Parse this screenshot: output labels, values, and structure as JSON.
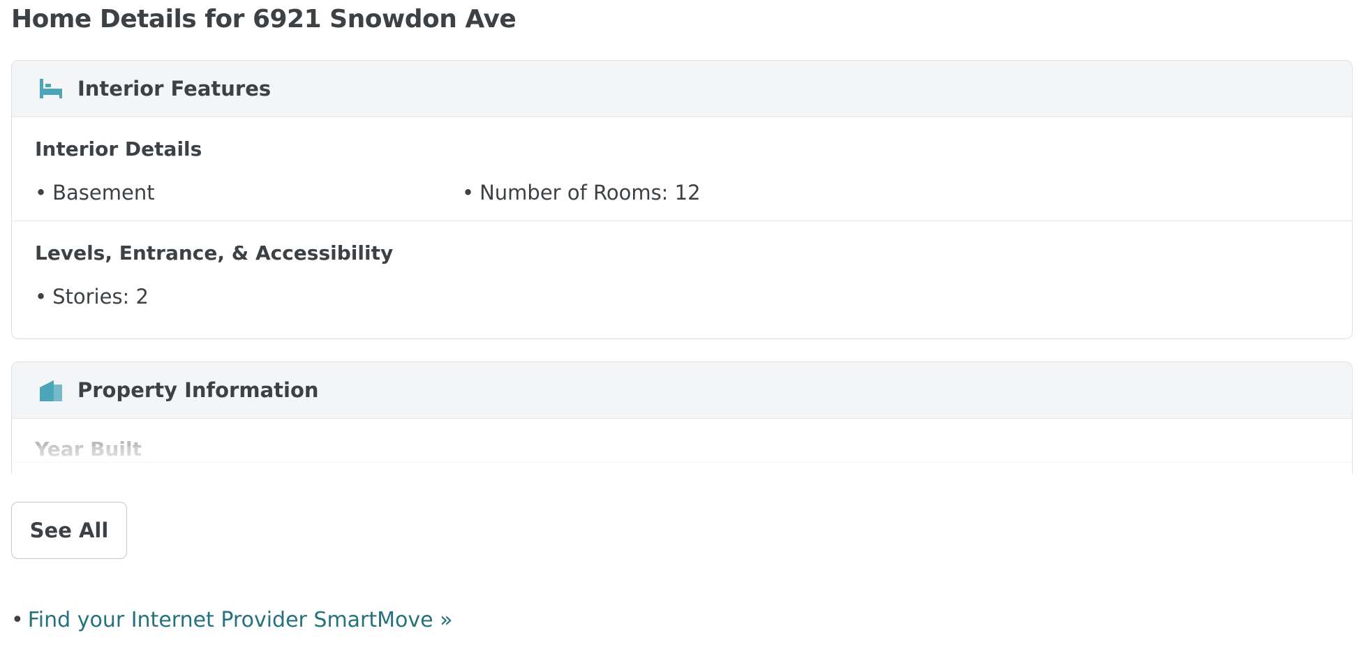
{
  "page": {
    "title": "Home Details for 6921 Snowdon Ave"
  },
  "interior_features": {
    "header": "Interior Features",
    "icon": "bed-icon",
    "sections": [
      {
        "title": "Interior Details",
        "items": [
          "Basement",
          "Number of Rooms: 12"
        ]
      },
      {
        "title": "Levels, Entrance, & Accessibility",
        "items": [
          "Stories: 2"
        ]
      }
    ]
  },
  "property_information": {
    "header": "Property Information",
    "icon": "house-icon",
    "first_section_title": "Year Built"
  },
  "see_all": {
    "label": "See All"
  },
  "provider_link": {
    "bullet": "•",
    "label": "Find your Internet Provider SmartMove »"
  },
  "colors": {
    "accent_icon": "#4aa6b8",
    "link": "#23727e",
    "header_bg": "#f4f5f6",
    "text": "#3b4144"
  }
}
